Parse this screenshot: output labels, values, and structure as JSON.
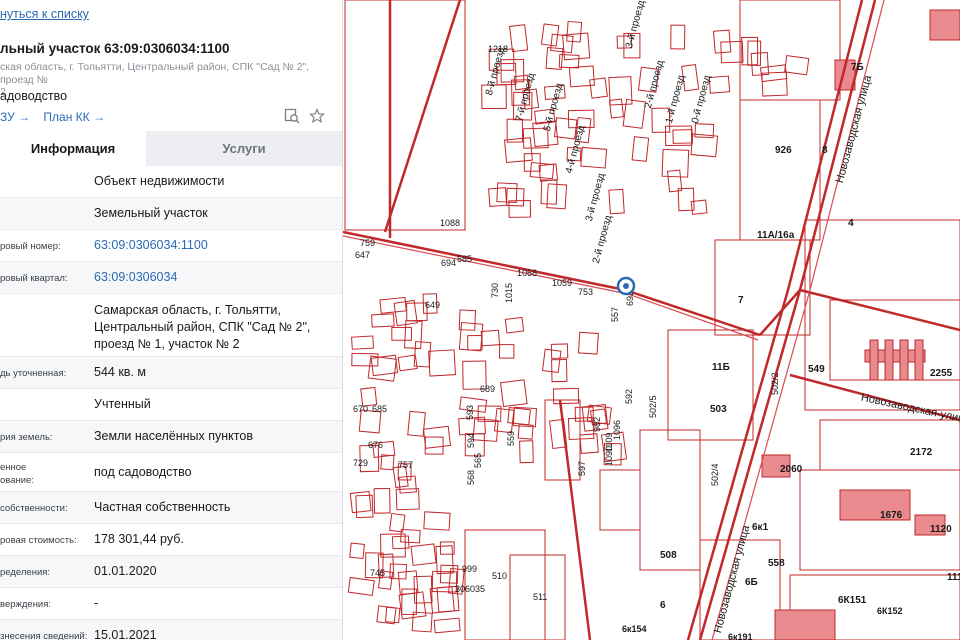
{
  "panel": {
    "back_link": "нуться к списку",
    "title": "льный участок 63:09:0306034:1100",
    "address": "ская область, г. Тольятти, Центральный район, СПК \"Сад № 2\", проезд №\n2",
    "usage": "адоводство",
    "links": {
      "first": "ЗУ →",
      "second": "План КК →"
    },
    "tabs": {
      "info": "Информация",
      "services": "Услуги"
    },
    "rows": [
      {
        "label": "",
        "value": "Объект недвижимости",
        "link": false
      },
      {
        "label": "",
        "value": "Земельный участок",
        "link": false
      },
      {
        "label": "ровый номер:",
        "value": "63:09:0306034:1100",
        "link": true
      },
      {
        "label": "ровый квартал:",
        "value": "63:09:0306034",
        "link": true
      },
      {
        "label": "",
        "value": "Самарская область, г. Тольятти, Центральный район, СПК \"Сад № 2\", проезд № 1, участок № 2",
        "link": false
      },
      {
        "label": "дь уточненная:",
        "value": "544 кв. м",
        "link": false
      },
      {
        "label": "",
        "value": "Учтенный",
        "link": false
      },
      {
        "label": "рия земель:",
        "value": "Земли населённых пунктов",
        "link": false
      },
      {
        "label": "енное\nование:",
        "value": "под садоводство",
        "link": false
      },
      {
        "label": "собственности:",
        "value": "Частная собственность",
        "link": false
      },
      {
        "label": "ровая стоимость:",
        "value": "178 301,44 руб.",
        "link": false
      },
      {
        "label": "ределения:",
        "value": "01.01.2020",
        "link": false
      },
      {
        "label": "верждения:",
        "value": "-",
        "link": false
      },
      {
        "label": "знесения сведений:",
        "value": "15.01.2021",
        "link": false
      }
    ]
  },
  "map": {
    "street_labels": [
      "Новозаводская улица",
      "Новозаводская улица",
      "Новозаводская-улица"
    ],
    "passage_labels": [
      "8-й проезд",
      "7-й проезд",
      "5-й проезд",
      "4-й проезд",
      "3-й проезд",
      "2-й проезд",
      "3-й проезд",
      "2-й проезд",
      "1-й проезд",
      "0-й проезд"
    ],
    "parcel_labels": [
      "1218",
      "1088",
      "759",
      "647",
      "694",
      "585",
      "1058",
      "1059",
      "753",
      "730",
      "1015",
      "692",
      "557",
      "649",
      "689",
      "670",
      "685",
      "676",
      "593",
      "594",
      "565",
      "568",
      "559",
      "757",
      "729",
      "982",
      "1096",
      "1109",
      "1090",
      "597",
      "502/5",
      "592",
      "502/4",
      "502/2",
      "503",
      "11Б",
      "11А/16а",
      "926",
      "8",
      "7",
      "4",
      "7Б",
      "2255",
      "549",
      "2172",
      "2060",
      "1676",
      "1120",
      "1119",
      "508",
      "6Б",
      "558",
      "6к1",
      "6",
      "6К151",
      "6К152",
      "6к154",
      "6к191",
      "745",
      "999",
      "306035",
      "510",
      "511"
    ],
    "colors": {
      "line": "#c0282a",
      "fill": "#e98a8e",
      "accent": "#d94b51",
      "marker": "#2a6ab7"
    }
  }
}
